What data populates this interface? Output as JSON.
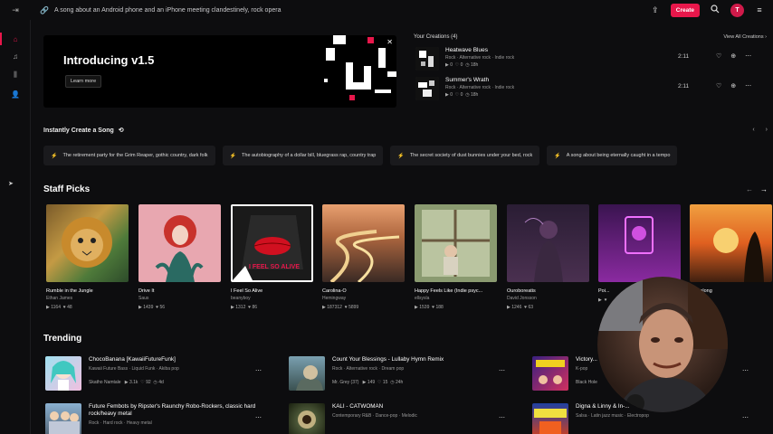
{
  "topbar": {
    "prompt": "A song about an Android phone and an iPhone meeting clandestinely, rock opera",
    "create_label": "Create",
    "avatar_letter": "T"
  },
  "hero": {
    "title": "Introducing v1.5",
    "button": "Learn more"
  },
  "creations": {
    "header": "Your Creations (4)",
    "view_all": "View All Creations",
    "items": [
      {
        "title": "Heatwave Blues",
        "tags": "Rock  ·  Alternative rock  ·  Indie rock",
        "plays": "0",
        "likes": "0",
        "age": "18h",
        "duration": "2:11"
      },
      {
        "title": "Summer's Wrath",
        "tags": "Rock  ·  Alternative rock  ·  Indie rock",
        "plays": "0",
        "likes": "0",
        "age": "18h",
        "duration": "2:11"
      }
    ]
  },
  "instant": {
    "header": "Instantly Create a Song",
    "chips": [
      "The retirement party for the Grim Reaper, gothic country, dark folk",
      "The autobiography of a dollar bill, bluegrass rap, country trap",
      "The secret society of dust bunnies under your bed, rock",
      "A song about being eternally caught in a tempo"
    ]
  },
  "staff": {
    "header": "Staff Picks",
    "cards": [
      {
        "title": "Rumble in the Jungle",
        "artist": "Ethan James",
        "plays": "1164",
        "likes": "48"
      },
      {
        "title": "Drive It",
        "artist": "Saus",
        "plays": "1439",
        "likes": "56"
      },
      {
        "title": "I Feel So Alive",
        "artist": "beanyboy",
        "plays": "1312",
        "likes": "86"
      },
      {
        "title": "Carolina-O",
        "artist": "Hemingway",
        "plays": "187312",
        "likes": "5899"
      },
      {
        "title": "Happy Feels Like (Indie psyc...",
        "artist": "ellsysla",
        "plays": "1539",
        "likes": "188"
      },
      {
        "title": "Ouroboreatis",
        "artist": "David Jonsson",
        "plays": "1246",
        "likes": "63"
      },
      {
        "title": "Poi...",
        "artist": "",
        "plays": "",
        "likes": ""
      },
      {
        "title": "...t Belong",
        "artist": "",
        "plays": "",
        "likes": "51"
      }
    ],
    "cover_text_3": "I FEEL SO ALIVE"
  },
  "trending": {
    "header": "Trending",
    "items": [
      {
        "title": "ChocoBanana [KawaiiFutureFunk]",
        "tags": "Kawaii Future Bass  ·  Liquid Funk  ·  Akiba pop",
        "artist": "Skatho Namtale",
        "plays": "3.1k",
        "likes": "92",
        "age": "4d"
      },
      {
        "title": "Count Your Blessings - Lullaby Hymn Remix",
        "tags": "Rock  ·  Alternative rock  ·  Dream pop",
        "artist": "Mr. Grey (37)",
        "plays": "149",
        "likes": "15",
        "age": "24h"
      },
      {
        "title": "Victory...",
        "tags": "K-pop",
        "artist": "Black Hole",
        "plays": "",
        "likes": "",
        "age": ""
      },
      {
        "title": "Future Fembots by Ripster's Raunchy Robo-Rockers, classic hard rock/heavy metal",
        "tags": "Rock  ·  Hard rock  ·  Heavy metal",
        "artist": "",
        "plays": "",
        "likes": "",
        "age": ""
      },
      {
        "title": "KALI - CATWOMAN",
        "tags": "Contemporary R&B  ·  Dance-pop  ·  Melodic",
        "artist": "",
        "plays": "",
        "likes": "",
        "age": ""
      },
      {
        "title": "Digna & Linny & In-...",
        "tags": "Salsa  ·  Latin jazz music  ·  Electropop",
        "artist": "",
        "plays": "",
        "likes": "",
        "age": ""
      }
    ]
  },
  "colors": {
    "accent": "#e8174b",
    "background": "#0d0d0f"
  }
}
